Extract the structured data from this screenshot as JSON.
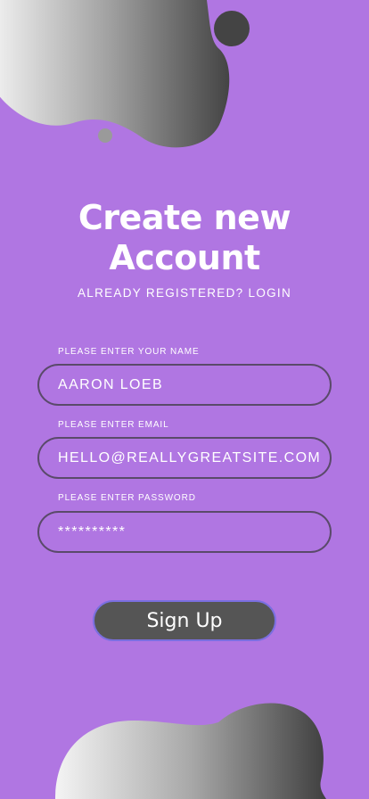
{
  "header": {
    "title_line1": "Create new",
    "title_line2": "Account",
    "login_link": "ALREADY REGISTERED? LOGIN"
  },
  "form": {
    "name_label": "PLEASE ENTER YOUR NAME",
    "name_value": "AARON LOEB",
    "email_label": "PLEASE ENTER EMAIL",
    "email_value": "HELLO@REALLYGREATSITE.COM",
    "password_label": "PLEASE ENTER PASSWORD",
    "password_value": "**********",
    "submit_label": "Sign Up"
  },
  "colors": {
    "background": "#b076e2",
    "button": "#555555",
    "field_border": "#5a4a6a"
  }
}
